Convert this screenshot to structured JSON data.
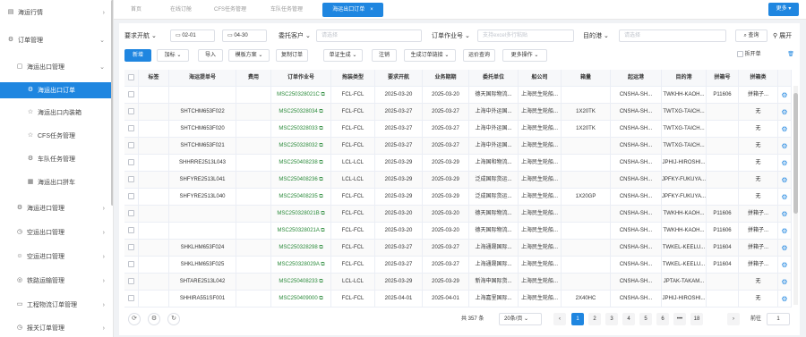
{
  "sidebar": {
    "items": [
      {
        "label": "海运行情",
        "icon": "chart-icon",
        "arrow": "›"
      },
      {
        "label": "订单管理",
        "icon": "gear-icon",
        "arrow": "⌄"
      },
      {
        "label": "海运出口管理",
        "icon": "folder-icon",
        "arrow": "⌄"
      },
      {
        "label": "海运出口订单",
        "icon": "gear-icon",
        "arrow": ""
      },
      {
        "label": "海运出口内装箱",
        "icon": "star-icon",
        "arrow": ""
      },
      {
        "label": "CFS任务管理",
        "icon": "star-icon",
        "arrow": ""
      },
      {
        "label": "车队任务管理",
        "icon": "gear-icon",
        "arrow": ""
      },
      {
        "label": "海运出口拼车",
        "icon": "grid-icon",
        "arrow": ""
      },
      {
        "label": "海运进口管理",
        "icon": "gear-icon",
        "arrow": "›"
      },
      {
        "label": "空运出口管理",
        "icon": "clock-icon",
        "arrow": "›"
      },
      {
        "label": "空运进口管理",
        "icon": "user-icon",
        "arrow": "›"
      },
      {
        "label": "铁路运输管理",
        "icon": "circle-icon",
        "arrow": "›"
      },
      {
        "label": "工程物流订单管理",
        "icon": "monitor-icon",
        "arrow": "›"
      },
      {
        "label": "报关订单管理",
        "icon": "clock-icon",
        "arrow": "›"
      }
    ]
  },
  "tabs": [
    "首页",
    "在线订舱",
    "CFS任务管理",
    "车队任务管理",
    "海运出口订单"
  ],
  "more_label": "更多",
  "filters": {
    "date_type": "要求开航",
    "date_from": "02-01",
    "date_to": "04-30",
    "client_label": "委托客户",
    "client_placeholder": "请选择",
    "order_no_label": "订单作业号",
    "order_no_placeholder": "支持excel多行粘贴",
    "dest_label": "目的港",
    "dest_placeholder": "请选择",
    "search_label": "查询",
    "expand_label": "展开"
  },
  "toolbar": {
    "new": "新增",
    "tag": "加标",
    "import": "导入",
    "template": "模板方案",
    "copy": "复制订单",
    "doc_gen": "单证生成",
    "cancel": "注销",
    "gen_link": "生成订单链接",
    "freight": "运价查询",
    "more_ops": "更多操作",
    "split_label": "拆开单"
  },
  "table": {
    "headers": [
      "标签",
      "海运提单号",
      "费用",
      "订单作业号",
      "拖装类型",
      "要求开航",
      "业务期期",
      "委托单位",
      "船公司",
      "箱量",
      "起运港",
      "目的港",
      "拼箱号",
      "拼箱类"
    ],
    "rows": [
      [
        "",
        "",
        "",
        "MSC250328021C",
        "FCL-FCL",
        "2025-03-20",
        "2025-03-20",
        "德天国际物流...",
        "上海民生轮船...",
        "",
        "CNSHA-SH...",
        "TWKHH-KAOH...",
        "P11606",
        "拼箱子..."
      ],
      [
        "",
        "SHTCHM653F022",
        "",
        "MSC250328034",
        "FCL-FCL",
        "2025-03-27",
        "2025-03-27",
        "上海中外运国...",
        "上海民生轮船...",
        "1X20TK",
        "CNSHA-SH...",
        "TWTXG-TAICH...",
        "",
        "无"
      ],
      [
        "",
        "SHTCHM653F020",
        "",
        "MSC250328033",
        "FCL-FCL",
        "2025-03-27",
        "2025-03-27",
        "上海中外运国...",
        "上海民生轮船...",
        "1X20TK",
        "CNSHA-SH...",
        "TWTXG-TAICH...",
        "",
        "无"
      ],
      [
        "",
        "SHTCHM653F021",
        "",
        "MSC250328032",
        "FCL-FCL",
        "2025-03-27",
        "2025-03-27",
        "上海中外运国...",
        "上海民生轮船...",
        "",
        "CNSHA-SH...",
        "TWTXG-TAICH...",
        "",
        "无"
      ],
      [
        "",
        "SHHRRE2513L043",
        "",
        "MSC250408238",
        "LCL-LCL",
        "2025-03-29",
        "2025-03-29",
        "上海国和物流...",
        "上海民生轮船...",
        "",
        "CNSHA-SH...",
        "JPHIJ-HIROSHI...",
        "",
        "无"
      ],
      [
        "",
        "SHFYRE2513L041",
        "",
        "MSC250408236",
        "LCL-LCL",
        "2025-03-29",
        "2025-03-29",
        "泛成国际货运...",
        "上海民生轮船...",
        "",
        "CNSHA-SH...",
        "JPFKY-FUKUYA...",
        "",
        "无"
      ],
      [
        "",
        "SHFYRE2513L040",
        "",
        "MSC250408235",
        "FCL-FCL",
        "2025-03-29",
        "2025-03-29",
        "泛成国际货运...",
        "上海民生轮船...",
        "1X20GP",
        "CNSHA-SH...",
        "JPFKY-FUKUYA...",
        "",
        "无"
      ],
      [
        "",
        "",
        "",
        "MSC250328021B",
        "FCL-FCL",
        "2025-03-20",
        "2025-03-20",
        "德天国际物流...",
        "上海民生轮船...",
        "",
        "CNSHA-SH...",
        "TWKHH-KAOH...",
        "P11606",
        "拼箱子..."
      ],
      [
        "",
        "",
        "",
        "MSC250328021A",
        "FCL-FCL",
        "2025-03-20",
        "2025-03-20",
        "德天国际物流...",
        "上海民生轮船...",
        "",
        "CNSHA-SH...",
        "TWKHH-KAOH...",
        "P11606",
        "拼箱子..."
      ],
      [
        "",
        "SHKLHM653F024",
        "",
        "MSC250328298",
        "FCL-FCL",
        "2025-03-27",
        "2025-03-27",
        "上海通晟国际...",
        "上海民生轮船...",
        "",
        "CNSHA-SH...",
        "TWKEL-KEELU...",
        "P11604",
        "拼箱子..."
      ],
      [
        "",
        "SHKLHM653F025",
        "",
        "MSC250328029A",
        "FCL-FCL",
        "2025-03-27",
        "2025-03-27",
        "上海通晟国际...",
        "上海民生轮船...",
        "",
        "CNSHA-SH...",
        "TWKEL-KEELU...",
        "P11604",
        "拼箱子..."
      ],
      [
        "",
        "SHTARE2513L042",
        "",
        "MSC250408233",
        "LCL-LCL",
        "2025-03-29",
        "2025-03-29",
        "新海申国际货...",
        "上海民生轮船...",
        "",
        "CNSHA-SH...",
        "JPTAK-TAKAM...",
        "",
        "无"
      ],
      [
        "",
        "SHHIRA551SF001",
        "",
        "MSC250409000",
        "FCL-FCL",
        "2025-04-01",
        "2025-04-01",
        "上海嘉里国际...",
        "上海民生轮船...",
        "2X40HC",
        "CNSHA-SH...",
        "JPHIJ-HIROSHI...",
        "",
        "无"
      ]
    ]
  },
  "pagination": {
    "total": "共 357 条",
    "page_size": "20条/页",
    "pages": [
      "1",
      "2",
      "3",
      "4",
      "5",
      "6",
      "•••",
      "18"
    ],
    "current": "1",
    "goto_label": "前往",
    "goto_value": "1",
    "prev": "‹",
    "next": "›"
  },
  "colors": {
    "primary": "#1f86e0",
    "link": "#2a8a3a"
  }
}
